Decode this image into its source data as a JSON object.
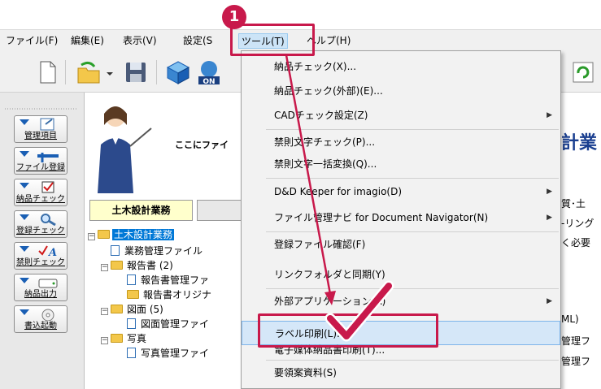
{
  "menubar": {
    "items": [
      "ファイル(F)",
      "編集(E)",
      "表示(V)",
      "設定(S",
      "ツール(T)",
      "ヘルプ(H)"
    ]
  },
  "left_panel": {
    "buttons": [
      "管理項目",
      "ファイル登録",
      "納品チェック",
      "登録チェック",
      "禁則チェック",
      "納品出力",
      "書込起動"
    ]
  },
  "banner": {
    "text": "ここにファイ"
  },
  "tabs": {
    "active": "土木設計業務"
  },
  "tree": {
    "rows": [
      "土木設計業務",
      "業務管理ファイル",
      "報告書 (2)",
      "報告書管理ファ",
      "報告書オリジナ",
      "図面 (5)",
      "図面管理ファイ",
      "写真",
      "写真管理ファイ"
    ]
  },
  "behind": {
    "big_title": "計業",
    "line1": "質･土",
    "line2": "-リング",
    "line3": "く必要",
    "line4": "ML)",
    "line5": "管理フ",
    "line6": "管理フ"
  },
  "dropdown": {
    "items": [
      "納品チェック(X)...",
      "納品チェック(外部)(E)...",
      "CADチェック設定(Z)",
      "禁則文字チェック(P)...",
      "禁則文字一括変換(Q)...",
      "D&D Keeper for imagio(D)",
      "ファイル管理ナビ for Document Navigator(N)",
      "登録ファイル確認(F)",
      "リンクフォルダと同期(Y)",
      "外部アプリケーション(A)",
      "ラベル印刷(L)...",
      "電子媒体納品書印刷(T)...",
      "要領案資料(S)"
    ]
  },
  "annotation": {
    "step": "1"
  },
  "colors": {
    "accent": "#c8194b",
    "selection": "#0078d7",
    "menu_highlight": "#d5e7f8"
  }
}
